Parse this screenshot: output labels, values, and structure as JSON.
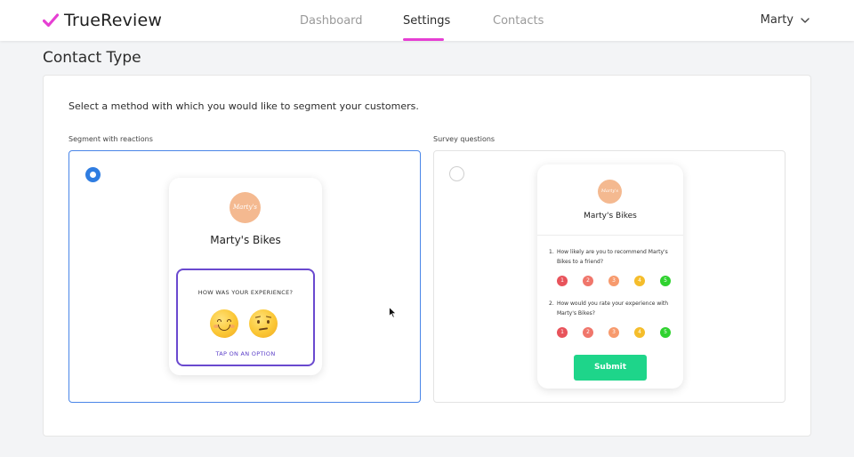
{
  "brand": {
    "name": "TrueReview",
    "icon": "check-icon",
    "accent": "#e63fd3"
  },
  "nav": {
    "items": [
      "Dashboard",
      "Settings",
      "Contacts"
    ],
    "active": "Settings"
  },
  "user": {
    "name": "Marty",
    "icon": "chevron-down-icon"
  },
  "page": {
    "title": "Contact Type"
  },
  "card": {
    "intro": "Select a method with which you would like to segment your customers.",
    "options": [
      {
        "label": "Segment with reactions",
        "selected": true,
        "preview": {
          "business_name": "Marty's Bikes",
          "logo_text": "Marty's",
          "question": "HOW WAS YOUR EXPERIENCE?",
          "reactions": [
            "smiling-face-icon",
            "confused-face-icon"
          ],
          "hint": "TAP ON AN OPTION"
        }
      },
      {
        "label": "Survey questions",
        "selected": false,
        "preview": {
          "business_name": "Marty's Bikes",
          "logo_text": "Marty's",
          "questions": [
            {
              "num": "1.",
              "text": "How likely are you to recommend Marty's Bikes to a friend?"
            },
            {
              "num": "2.",
              "text": "How would you rate your experience with Marty's Bikes?"
            }
          ],
          "scale": [
            "1",
            "2",
            "3",
            "4",
            "5"
          ],
          "scale_colors": [
            "#e8535b",
            "#f0766b",
            "#f79a6d",
            "#f5bd2b",
            "#2fd22f"
          ],
          "submit_label": "Submit"
        }
      }
    ]
  },
  "colors": {
    "selected_border": "#4a86e8",
    "reaction_border": "#6a49cf",
    "submit": "#1ed58a"
  }
}
